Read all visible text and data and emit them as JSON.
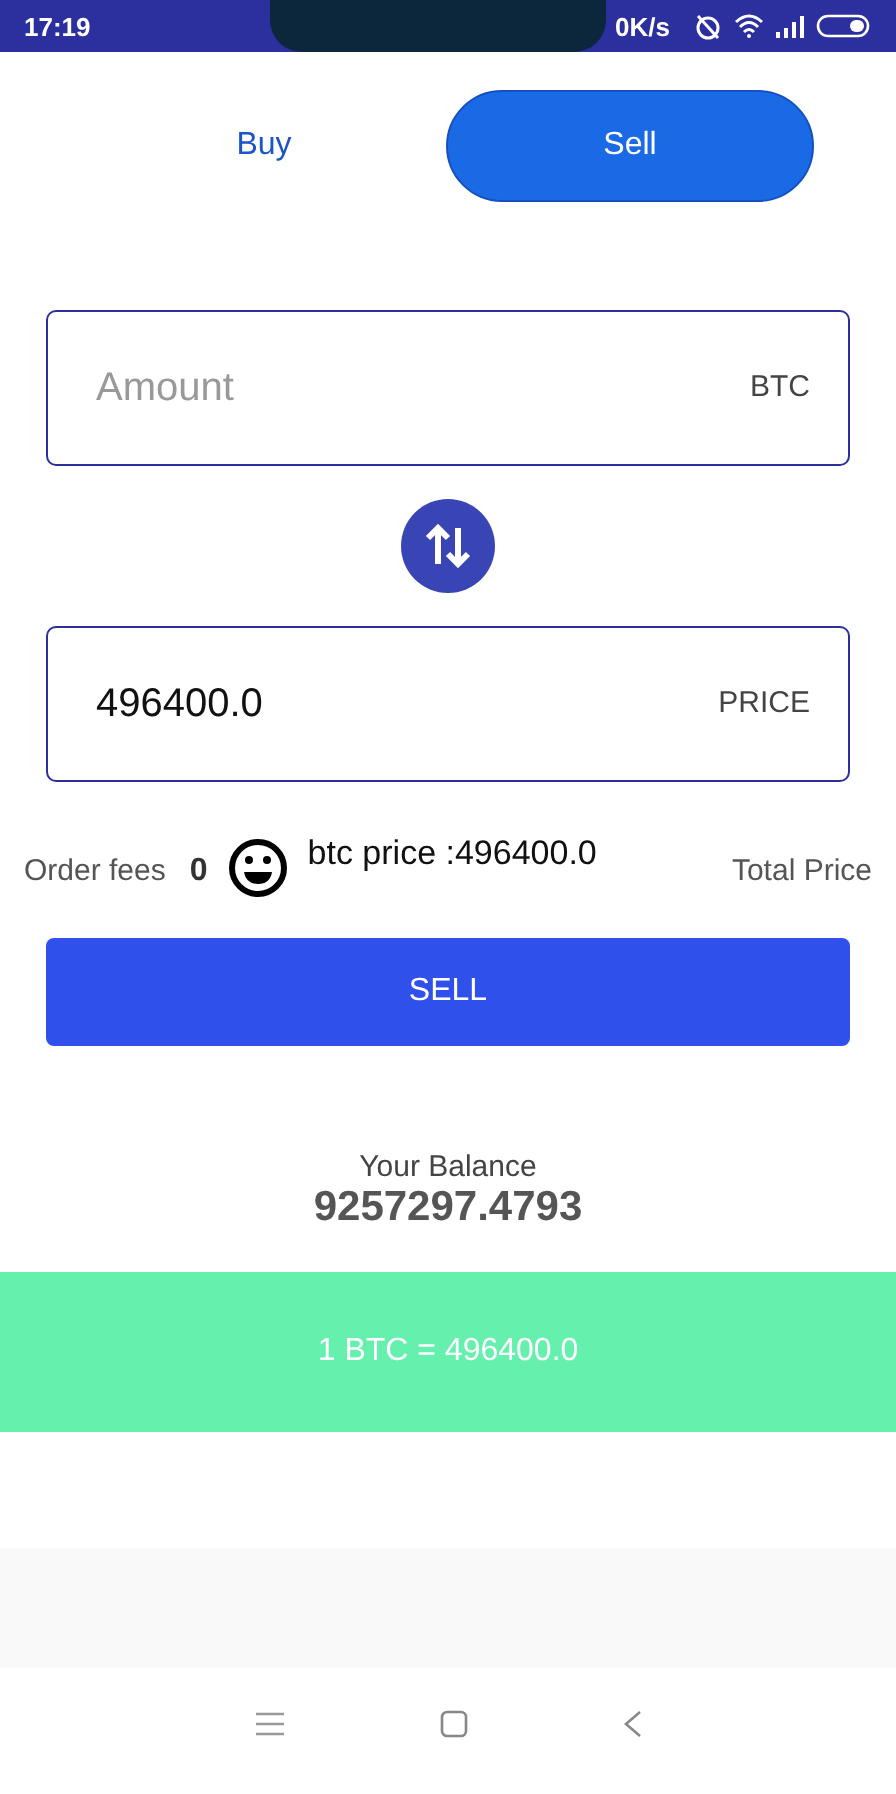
{
  "status_bar": {
    "time": "17:19",
    "speed": "0K/s"
  },
  "tabs": [
    {
      "label": "Buy",
      "selected": false
    },
    {
      "label": "Sell",
      "selected": true
    }
  ],
  "amount_field": {
    "placeholder": "Amount",
    "unit": "BTC"
  },
  "price_field": {
    "value": "496400.0",
    "unit": "PRICE"
  },
  "order_fees": {
    "label": "Order fees",
    "value": "0"
  },
  "btc_price": "btc price :496400.0",
  "total_price": "Total Price",
  "sell_button": "SELL",
  "balance": {
    "label": "Your Balance",
    "value": "9257297.4793"
  },
  "rate_banner": "1 BTC = 496400.0"
}
